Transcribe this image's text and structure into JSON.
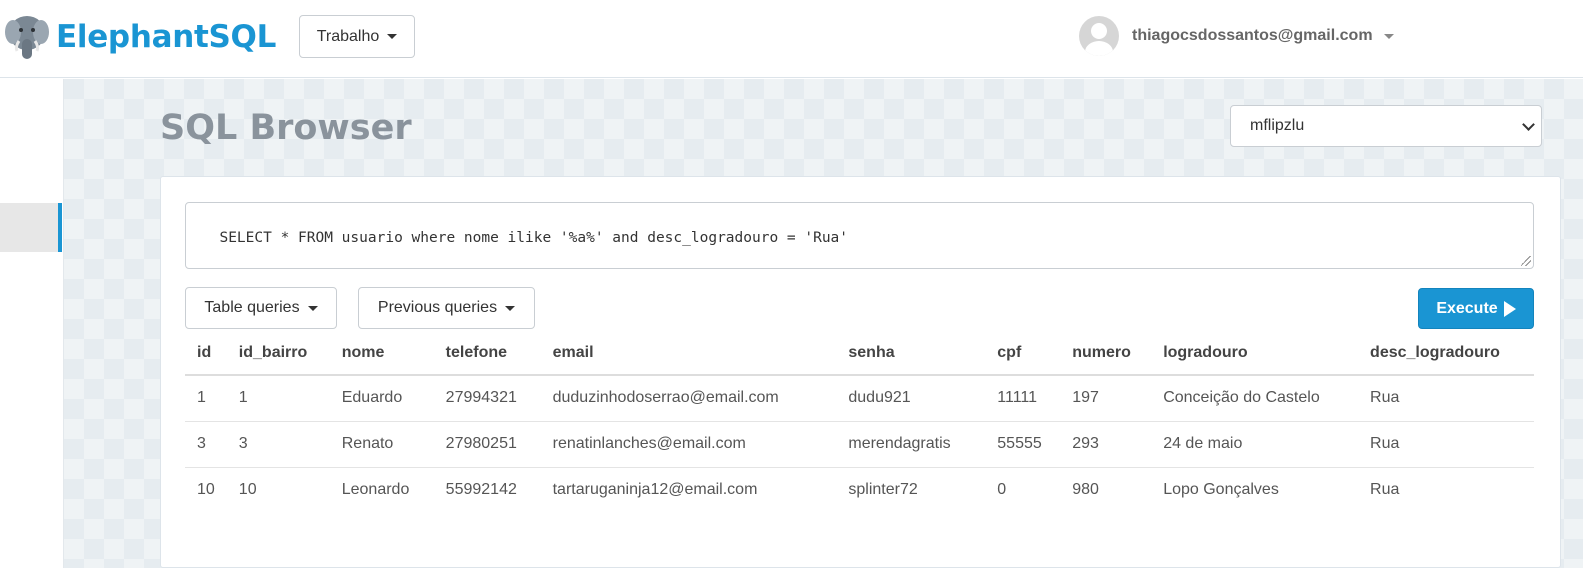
{
  "brand": {
    "name": "ElephantSQL",
    "logo_icon": "elephant-logo-icon"
  },
  "team_selector": {
    "label": "Trabalho"
  },
  "user_menu": {
    "email": "thiagocsdossantos@gmail.com",
    "avatar_icon": "user-avatar-icon"
  },
  "page": {
    "title": "SQL Browser"
  },
  "database_select": {
    "selected": "mflipzlu"
  },
  "query": {
    "text": "SELECT * FROM usuario where nome ilike '%a%' and desc_logradouro = 'Rua'"
  },
  "buttons": {
    "table_queries": "Table queries",
    "previous_queries": "Previous queries",
    "execute": "Execute"
  },
  "colors": {
    "accent": "#1a95d3",
    "title_gray": "#8a939c"
  },
  "results": {
    "columns": [
      "id",
      "id_bairro",
      "nome",
      "telefone",
      "email",
      "senha",
      "cpf",
      "numero",
      "logradouro",
      "desc_logradouro"
    ],
    "rows": [
      [
        "1",
        "1",
        "Eduardo",
        "27994321",
        "duduzinhodoserrao@email.com",
        "dudu921",
        "11111",
        "197",
        "Conceição do Castelo",
        "Rua"
      ],
      [
        "3",
        "3",
        "Renato",
        "27980251",
        "renatinlanches@email.com",
        "merendagratis",
        "55555",
        "293",
        "24 de maio",
        "Rua"
      ],
      [
        "10",
        "10",
        "Leonardo",
        "55992142",
        "tartaruganinja12@email.com",
        "splinter72",
        "0",
        "980",
        "Lopo Gonçalves",
        "Rua"
      ]
    ]
  }
}
